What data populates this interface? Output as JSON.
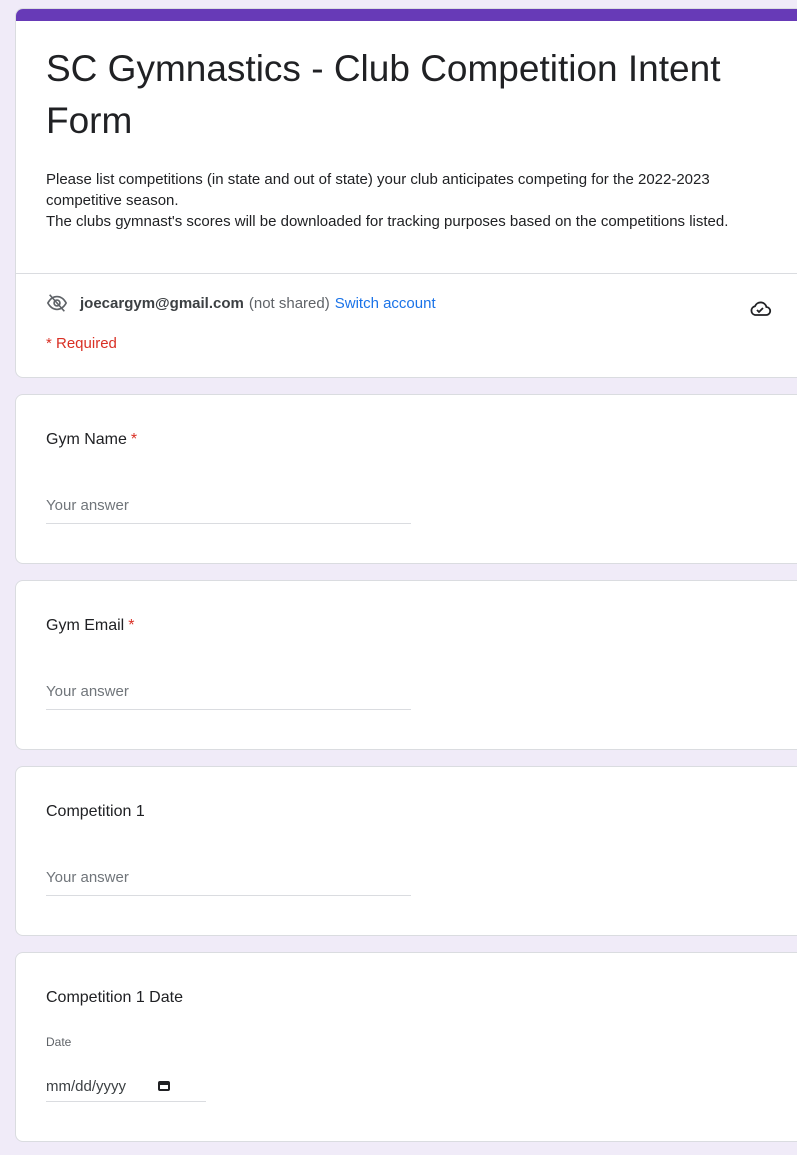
{
  "form": {
    "title": "SC Gymnastics - Club Competition Intent Form",
    "description_lines": [
      "Please list competitions (in state and out of state) your club anticipates competing for the 2022-2023 competitive season.",
      "The clubs gymnast's scores will be downloaded for tracking purposes based on the competitions listed."
    ],
    "accent_color": "#673ab7"
  },
  "account": {
    "email": "joecargym@gmail.com",
    "not_shared": "(not shared)",
    "switch_label": "Switch account",
    "visibility_icon": "eye-off-icon",
    "cloud_icon": "cloud-icon"
  },
  "required_note": "* Required",
  "questions": [
    {
      "title": "Gym Name",
      "required": true,
      "asterisk": "*",
      "placeholder": "Your answer"
    },
    {
      "title": "Gym Email",
      "required": true,
      "asterisk": "*",
      "placeholder": "Your answer"
    },
    {
      "title": "Competition 1",
      "required": false,
      "placeholder": "Your answer"
    },
    {
      "title": "Competition 1 Date",
      "required": false,
      "date_label": "Date",
      "date_placeholder": "mm/dd/yyyy",
      "calendar_icon": "calendar-icon"
    }
  ]
}
